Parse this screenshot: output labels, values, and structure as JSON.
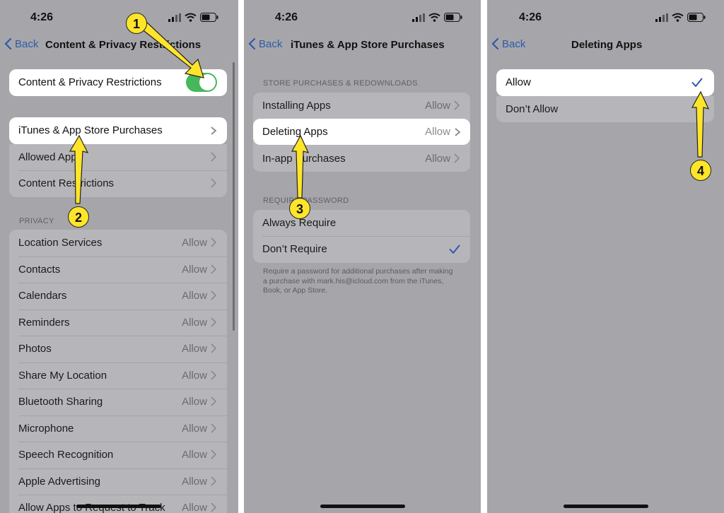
{
  "colors": {
    "accent": "#2f5aa8",
    "toggle_on": "#46b85a",
    "annotation": "#ffe52a",
    "dim_background": "#a6a6aa"
  },
  "panel1": {
    "time": "4:26",
    "back_label": "Back",
    "title": "Content & Privacy Restrictions",
    "toggle": {
      "label": "Content & Privacy Restrictions",
      "state": "on"
    },
    "top_rows": [
      {
        "label": "iTunes & App Store Purchases"
      },
      {
        "label": "Allowed Apps"
      },
      {
        "label": "Content Restrictions"
      }
    ],
    "privacy_header": "PRIVACY",
    "privacy_rows": [
      {
        "label": "Location Services",
        "value": "Allow"
      },
      {
        "label": "Contacts",
        "value": "Allow"
      },
      {
        "label": "Calendars",
        "value": "Allow"
      },
      {
        "label": "Reminders",
        "value": "Allow"
      },
      {
        "label": "Photos",
        "value": "Allow"
      },
      {
        "label": "Share My Location",
        "value": "Allow"
      },
      {
        "label": "Bluetooth Sharing",
        "value": "Allow"
      },
      {
        "label": "Microphone",
        "value": "Allow"
      },
      {
        "label": "Speech Recognition",
        "value": "Allow"
      },
      {
        "label": "Apple Advertising",
        "value": "Allow"
      },
      {
        "label": "Allow Apps to Request to Track",
        "value": "Allow"
      }
    ]
  },
  "panel2": {
    "time": "4:26",
    "back_label": "Back",
    "title": "iTunes & App Store Purchases",
    "store_header": "STORE PURCHASES & REDOWNLOADS",
    "store_rows": [
      {
        "label": "Installing Apps",
        "value": "Allow"
      },
      {
        "label": "Deleting Apps",
        "value": "Allow"
      },
      {
        "label": "In-app Purchases",
        "value": "Allow"
      }
    ],
    "password_header": "REQUIRE PASSWORD",
    "password_rows": [
      {
        "label": "Always Require",
        "selected": false
      },
      {
        "label": "Don’t Require",
        "selected": true
      }
    ],
    "note": "Require a password for additional purchases after making a purchase with mark.his@icloud.com from the iTunes, Book, or App Store."
  },
  "panel3": {
    "time": "4:26",
    "back_label": "Back",
    "title": "Deleting Apps",
    "options": [
      {
        "label": "Allow",
        "selected": true
      },
      {
        "label": "Don’t Allow",
        "selected": false
      }
    ]
  },
  "annotations": [
    "1",
    "2",
    "3",
    "4"
  ]
}
